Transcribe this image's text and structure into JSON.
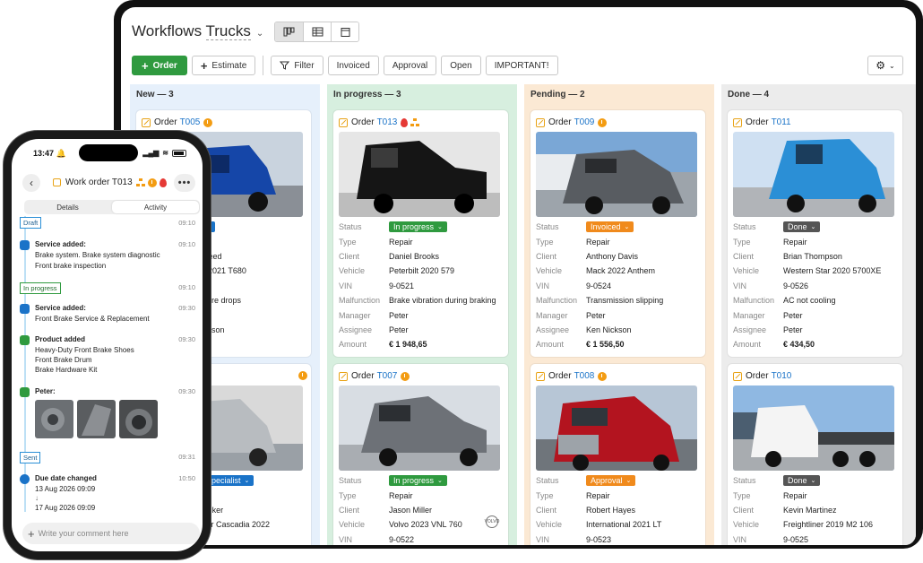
{
  "app": {
    "title_prefix": "Workflows ",
    "title_main": "Trucks"
  },
  "toolbar": {
    "order": "Order",
    "estimate": "Estimate",
    "filter": "Filter",
    "invoiced": "Invoiced",
    "approval": "Approval",
    "open": "Open",
    "important": "IMPORTANT!"
  },
  "colors": {
    "new": "#e6f0fb",
    "progress": "#d7efdf",
    "pending": "#fbe9d4",
    "done": "#ececec",
    "accent": "#2f9a3f",
    "link": "#1a73c8"
  },
  "labels": {
    "status": "Status",
    "type": "Type",
    "client": "Client",
    "vehicle": "Vehicle",
    "vin": "VIN",
    "malfunction": "Malfunction",
    "manager": "Manager",
    "assignee": "Assignee",
    "amount": "Amount",
    "order": "Order"
  },
  "columns": [
    {
      "title": "New — 3",
      "cards": [
        {
          "num": "T005",
          "status": "w",
          "rows": [
            "",
            "",
            "us Reed",
            "orth 2021 T680",
            "20",
            "ressure drops",
            "",
            "d Jonson",
            "0"
          ]
        },
        {
          "num": "",
          "status": "gn specialist",
          "rows": [
            "ir",
            "n Walker",
            "htliner Cascadia 2022",
            "19"
          ]
        }
      ]
    },
    {
      "title": "In progress — 3",
      "cards": [
        {
          "num": "T013",
          "status": "In progress",
          "type": "Repair",
          "client": "Daniel Brooks",
          "vehicle": "Peterbilt 2020 579",
          "vin": "9-0521",
          "malfunction": "Brake vibration during braking",
          "manager": "Peter",
          "assignee": "Peter",
          "amount": "€ 1 948,65"
        },
        {
          "num": "T007",
          "status": "In progress",
          "type": "Repair",
          "client": "Jason Miller",
          "vehicle": "Volvo 2023 VNL 760",
          "vin": "9-0522",
          "brand": "VOLVO"
        }
      ]
    },
    {
      "title": "Pending — 2",
      "cards": [
        {
          "num": "T009",
          "status": "Invoiced",
          "type": "Repair",
          "client": "Anthony Davis",
          "vehicle": "Mack 2022 Anthem",
          "vin": "9-0524",
          "malfunction": "Transmission slipping",
          "manager": "Peter",
          "assignee": "Ken Nickson",
          "amount": "€ 1 556,50"
        },
        {
          "num": "T008",
          "status": "Approval",
          "type": "Repair",
          "client": "Robert Hayes",
          "vehicle": "International 2021 LT",
          "vin": "9-0523"
        }
      ]
    },
    {
      "title": "Done — 4",
      "cards": [
        {
          "num": "T011",
          "status": "Done",
          "type": "Repair",
          "client": "Brian Thompson",
          "vehicle": "Western Star 2020 5700XE",
          "vin": "9-0526",
          "malfunction": "AC not cooling",
          "manager": "Peter",
          "assignee": "Peter",
          "amount": "€ 434,50"
        },
        {
          "num": "T010",
          "status": "Done",
          "type": "Repair",
          "client": "Kevin Martinez",
          "vehicle": "Freightliner 2019 M2 106",
          "vin": "9-0525"
        }
      ]
    }
  ],
  "phone": {
    "time": "13:47",
    "title": "Work order T013",
    "tabs": [
      "Details",
      "Activity"
    ],
    "tag_draft": "Draft",
    "time_draft": "09:10",
    "ev1": {
      "title": "Service added:",
      "time": "09:10",
      "l1": "Brake system. Brake system diagnostic",
      "l2": "Front brake inspection"
    },
    "tag_progress": "In progress",
    "time_progress": "09:10",
    "ev2": {
      "title": "Service added:",
      "time": "09:30",
      "l1": "Front Brake Service & Replacement"
    },
    "ev3": {
      "title": "Product added",
      "time": "09:30",
      "l1": "Heavy-Duty Front Brake Shoes",
      "l2": "Front Brake Drum",
      "l3": "Brake Hardware Kit"
    },
    "ev4": {
      "title": "Peter:",
      "time": "09:30"
    },
    "tag_sent": "Sent",
    "time_sent": "09:31",
    "ev5": {
      "title": "Due date changed",
      "time": "10:50",
      "l1": "13 Aug 2026 09:09",
      "arrow": "↓",
      "l2": "17 Aug 2026 09:09"
    },
    "comment_placeholder": "Write your comment here"
  }
}
